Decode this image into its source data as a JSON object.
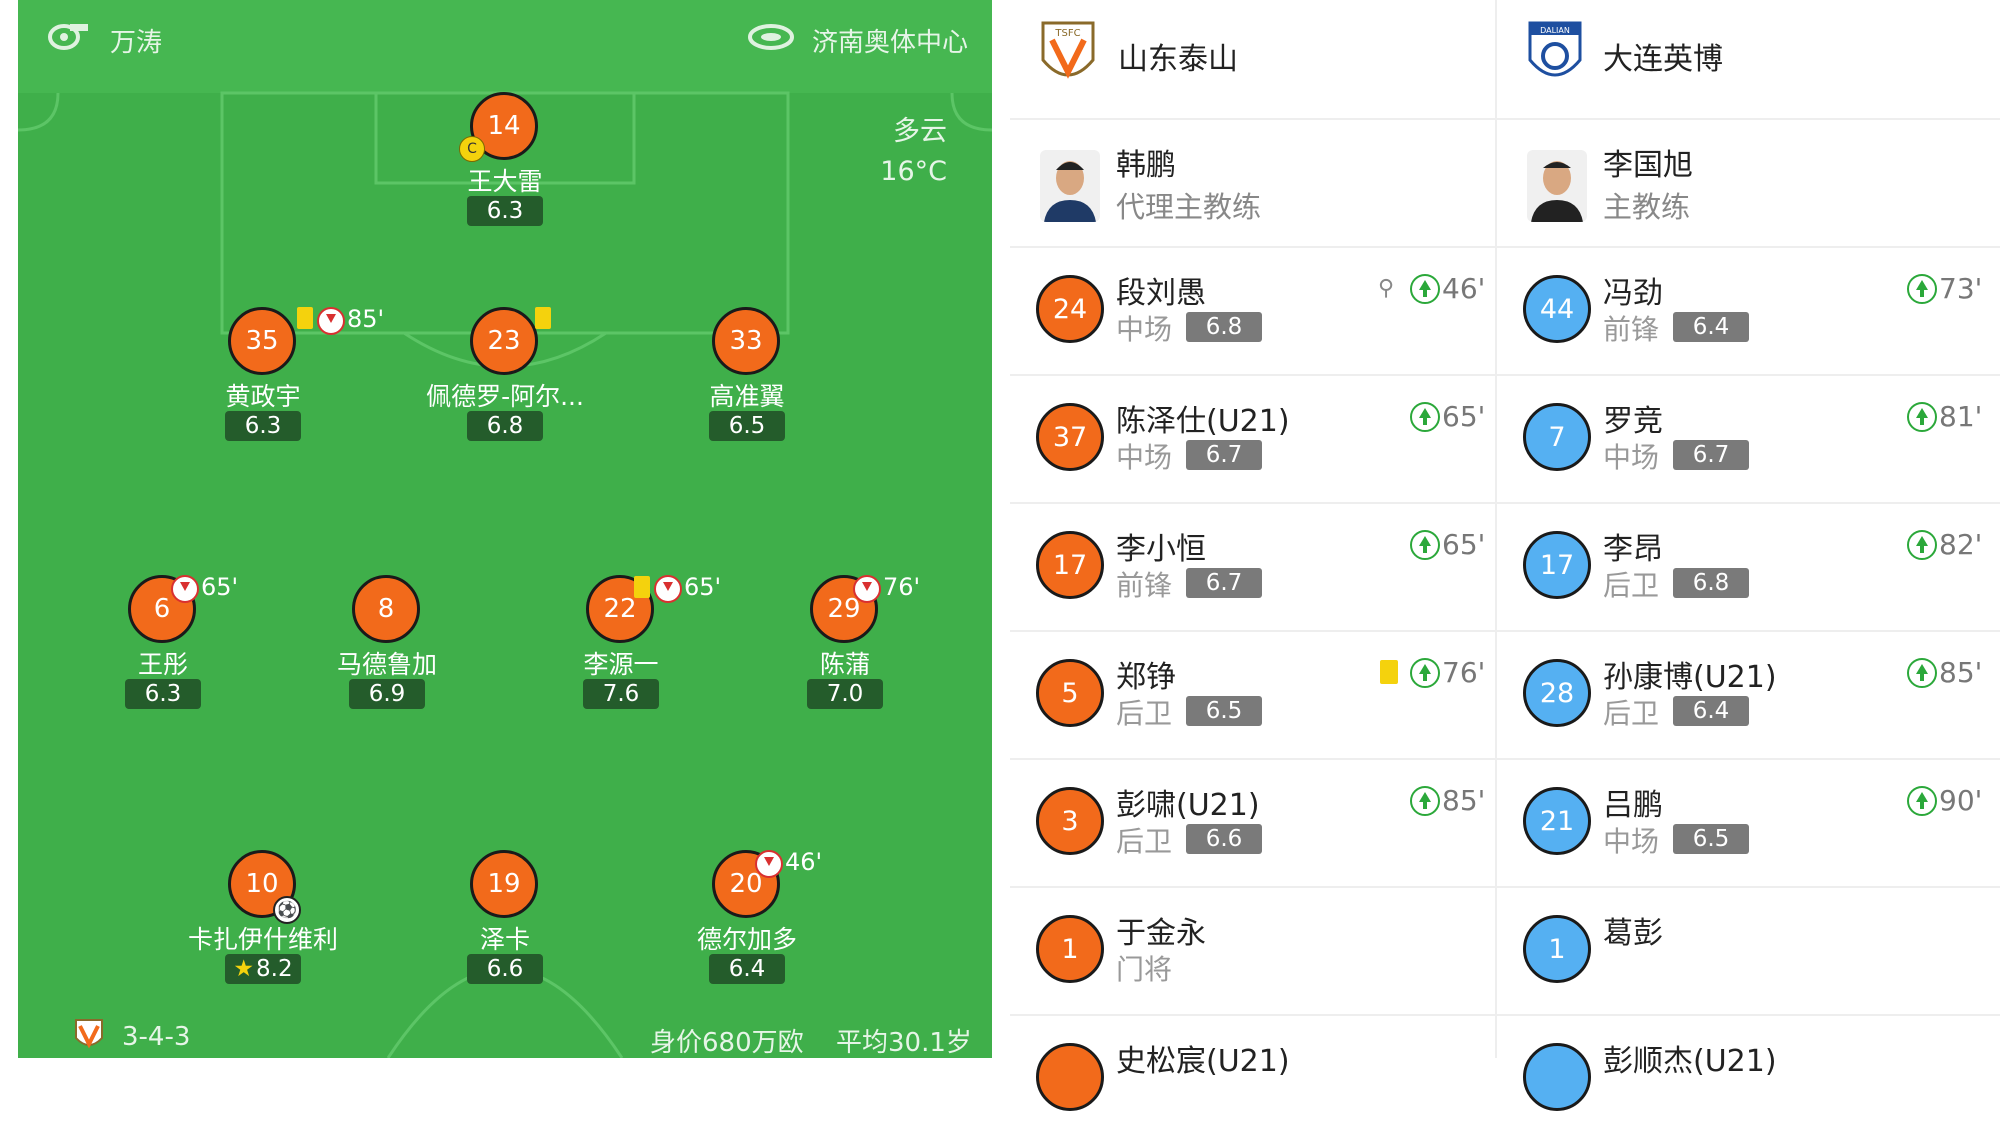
{
  "pitch": {
    "referee": "万涛",
    "venue": "济南奥体中心",
    "weather": "多云",
    "temperature": "16°C",
    "formation": "3-4-3",
    "value": "身价680万欧",
    "avg_age": "平均30.1岁"
  },
  "players": [
    {
      "num": "14",
      "name": "王大雷",
      "rating": "6.3",
      "captain": "C"
    },
    {
      "num": "35",
      "name": "黄政宇",
      "rating": "6.3",
      "sub_time": "85'"
    },
    {
      "num": "23",
      "name": "佩德罗-阿尔...",
      "rating": "6.8"
    },
    {
      "num": "33",
      "name": "高准翼",
      "rating": "6.5"
    },
    {
      "num": "6",
      "name": "王彤",
      "rating": "6.3",
      "sub_time": "65'"
    },
    {
      "num": "8",
      "name": "马德鲁加",
      "rating": "6.9"
    },
    {
      "num": "22",
      "name": "李源一",
      "rating": "7.6",
      "sub_time": "65'"
    },
    {
      "num": "29",
      "name": "陈蒲",
      "rating": "7.0",
      "sub_time": "76'"
    },
    {
      "num": "10",
      "name": "卡扎伊什维利",
      "rating": "8.2",
      "star": "★"
    },
    {
      "num": "19",
      "name": "泽卡",
      "rating": "6.6"
    },
    {
      "num": "20",
      "name": "德尔加多",
      "rating": "6.4",
      "sub_time": "46'"
    }
  ],
  "home": {
    "team": "山东泰山",
    "logo_text": "TSFC",
    "coach": {
      "name": "韩鹏",
      "role": "代理主教练"
    },
    "subs": [
      {
        "num": "24",
        "name": "段刘愚",
        "pos": "中场",
        "rating": "6.8",
        "in": "46'"
      },
      {
        "num": "37",
        "name": "陈泽仕(U21)",
        "pos": "中场",
        "rating": "6.7",
        "in": "65'"
      },
      {
        "num": "17",
        "name": "李小恒",
        "pos": "前锋",
        "rating": "6.7",
        "in": "65'"
      },
      {
        "num": "5",
        "name": "郑铮",
        "pos": "后卫",
        "rating": "6.5",
        "in": "76'"
      },
      {
        "num": "3",
        "name": "彭啸(U21)",
        "pos": "后卫",
        "rating": "6.6",
        "in": "85'"
      },
      {
        "num": "1",
        "name": "于金永",
        "pos": "门将"
      },
      {
        "num": "",
        "name": "史松宸(U21)",
        "pos": ""
      }
    ]
  },
  "away": {
    "team": "大连英博",
    "logo_text": "DALIAN",
    "coach": {
      "name": "李国旭",
      "role": "主教练"
    },
    "subs": [
      {
        "num": "44",
        "name": "冯劲",
        "pos": "前锋",
        "rating": "6.4",
        "in": "73'"
      },
      {
        "num": "7",
        "name": "罗竞",
        "pos": "中场",
        "rating": "6.7",
        "in": "81'"
      },
      {
        "num": "17",
        "name": "李昂",
        "pos": "后卫",
        "rating": "6.8",
        "in": "82'"
      },
      {
        "num": "28",
        "name": "孙康博(U21)",
        "pos": "后卫",
        "rating": "6.4",
        "in": "85'"
      },
      {
        "num": "21",
        "name": "吕鹏",
        "pos": "中场",
        "rating": "6.5",
        "in": "90'"
      },
      {
        "num": "1",
        "name": "葛彭",
        "pos": ""
      },
      {
        "num": "",
        "name": "彭顺杰(U21)",
        "pos": ""
      }
    ]
  },
  "colors": {
    "pitch": "#3faf4a",
    "home": "#f26a1b",
    "away": "#55b0f2",
    "card": "#f4d20d",
    "sub_in": "#2ba83a",
    "sub_out": "#d93030"
  }
}
